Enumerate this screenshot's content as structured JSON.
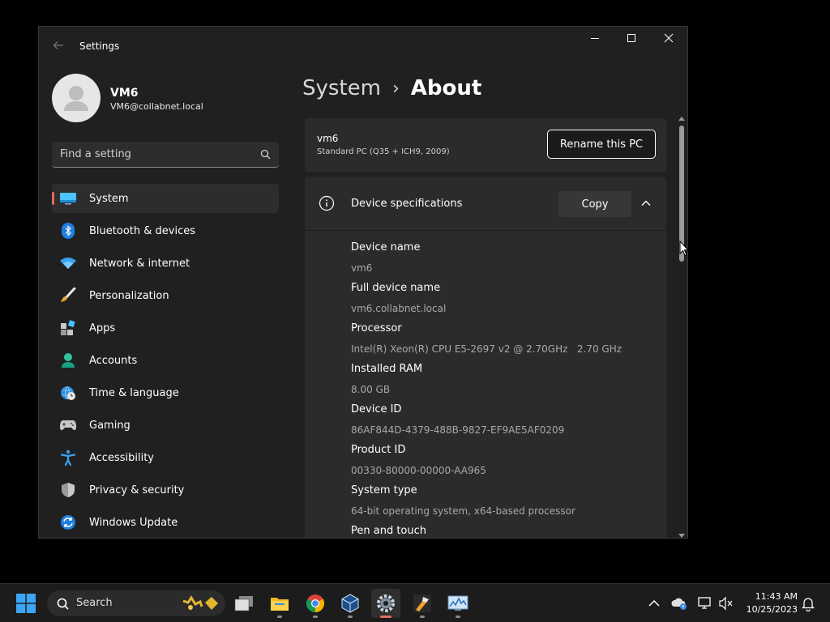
{
  "window": {
    "title": "Settings"
  },
  "profile": {
    "name": "VM6",
    "email": "VM6@collabnet.local"
  },
  "search": {
    "placeholder": "Find a setting"
  },
  "nav": {
    "items": [
      {
        "label": "System",
        "icon": "system-icon",
        "active": true
      },
      {
        "label": "Bluetooth & devices",
        "icon": "bluetooth-icon"
      },
      {
        "label": "Network & internet",
        "icon": "wifi-icon"
      },
      {
        "label": "Personalization",
        "icon": "brush-icon"
      },
      {
        "label": "Apps",
        "icon": "apps-icon"
      },
      {
        "label": "Accounts",
        "icon": "person-icon"
      },
      {
        "label": "Time & language",
        "icon": "globe-clock-icon"
      },
      {
        "label": "Gaming",
        "icon": "gamepad-icon"
      },
      {
        "label": "Accessibility",
        "icon": "accessibility-icon"
      },
      {
        "label": "Privacy & security",
        "icon": "shield-icon"
      },
      {
        "label": "Windows Update",
        "icon": "update-icon"
      }
    ]
  },
  "breadcrumb": {
    "parent": "System",
    "separator": "›",
    "current": "About"
  },
  "pc": {
    "name": "vm6",
    "model": "Standard PC (Q35 + ICH9, 2009)",
    "rename_label": "Rename this PC"
  },
  "specs": {
    "title": "Device specifications",
    "copy_label": "Copy",
    "rows": [
      {
        "label": "Device name",
        "value": "vm6"
      },
      {
        "label": "Full device name",
        "value": "vm6.collabnet.local"
      },
      {
        "label": "Processor",
        "value": "Intel(R) Xeon(R) CPU E5-2697 v2 @ 2.70GHz   2.70 GHz"
      },
      {
        "label": "Installed RAM",
        "value": "8.00 GB"
      },
      {
        "label": "Device ID",
        "value": "86AF844D-4379-488B-9827-EF9AE5AF0209"
      },
      {
        "label": "Product ID",
        "value": "00330-80000-00000-AA965"
      },
      {
        "label": "System type",
        "value": "64-bit operating system, x64-based processor"
      },
      {
        "label": "Pen and touch",
        "value": ""
      }
    ]
  },
  "taskbar": {
    "search_label": "Search",
    "time": "11:43 AM",
    "date": "10/25/2023"
  },
  "colors": {
    "accent": "#e36a5f",
    "background": "#202020",
    "card": "#2b2b2b"
  }
}
